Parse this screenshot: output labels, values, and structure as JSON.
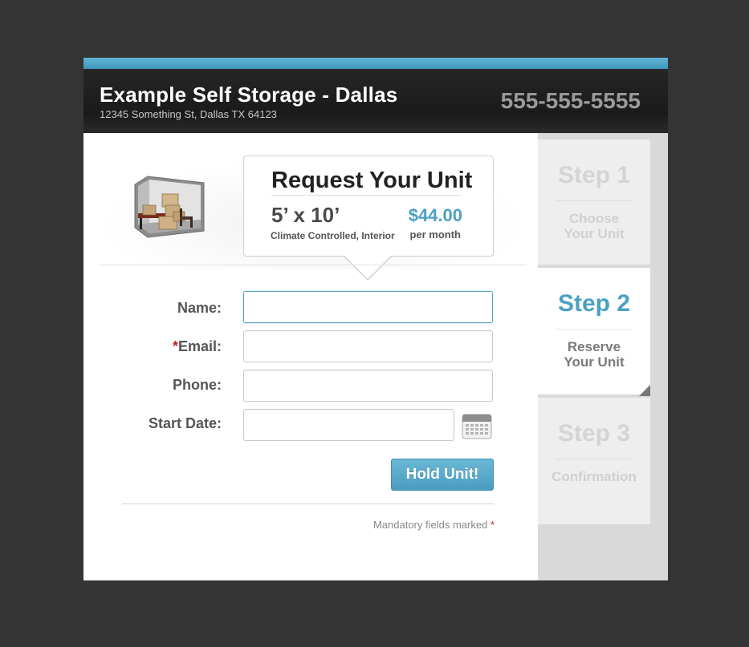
{
  "header": {
    "business_name": "Example Self Storage - Dallas",
    "address": "12345 Something St, Dallas TX 64123",
    "phone": "555-555-5555"
  },
  "unit": {
    "title": "Request Your Unit",
    "size": "5’ x 10’",
    "description": "Climate Controlled, Interior",
    "price": "$44.00",
    "price_period": "per month",
    "image_icon": "storage-unit-boxes-icon"
  },
  "form": {
    "fields": [
      {
        "label": "Name:",
        "required": false,
        "value": "",
        "placeholder": ""
      },
      {
        "label": "Email:",
        "required": true,
        "value": "",
        "placeholder": ""
      },
      {
        "label": "Phone:",
        "required": false,
        "value": "",
        "placeholder": ""
      },
      {
        "label": "Start Date:",
        "required": false,
        "value": "",
        "placeholder": ""
      }
    ],
    "required_mark": "*",
    "calendar_icon": "calendar-icon",
    "submit_label": "Hold Unit!",
    "mandatory_note": "Mandatory fields marked"
  },
  "steps": [
    {
      "title": "Step 1",
      "subtitle_line1": "Choose",
      "subtitle_line2": "Your Unit",
      "state": "done"
    },
    {
      "title": "Step 2",
      "subtitle_line1": "Reserve",
      "subtitle_line2": "Your Unit",
      "state": "active"
    },
    {
      "title": "Step 3",
      "subtitle_line1": "Confirmation",
      "subtitle_line2": "",
      "state": "upcoming"
    }
  ],
  "colors": {
    "accent": "#4ba0c3",
    "background": "#343434",
    "header": "#1f1f1f",
    "required": "#cc1f1f"
  }
}
